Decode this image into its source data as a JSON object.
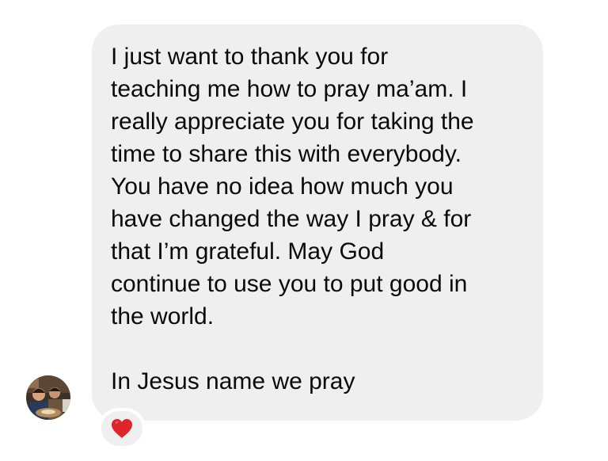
{
  "message": {
    "body": "I just want to thank you for\nteaching me how to pray ma’am. I\nreally appreciate you for taking the\ntime to share this with everybody.\nYou have no idea how much you\nhave changed the way I pray & for\nthat I’m grateful. May God\ncontinue to use you to put good in\nthe world.\n\nIn Jesus name we pray",
    "reaction_icon": "red-heart-icon",
    "bubble_color": "#efefef"
  },
  "sender": {
    "avatar_icon": "profile-photo-avatar"
  }
}
